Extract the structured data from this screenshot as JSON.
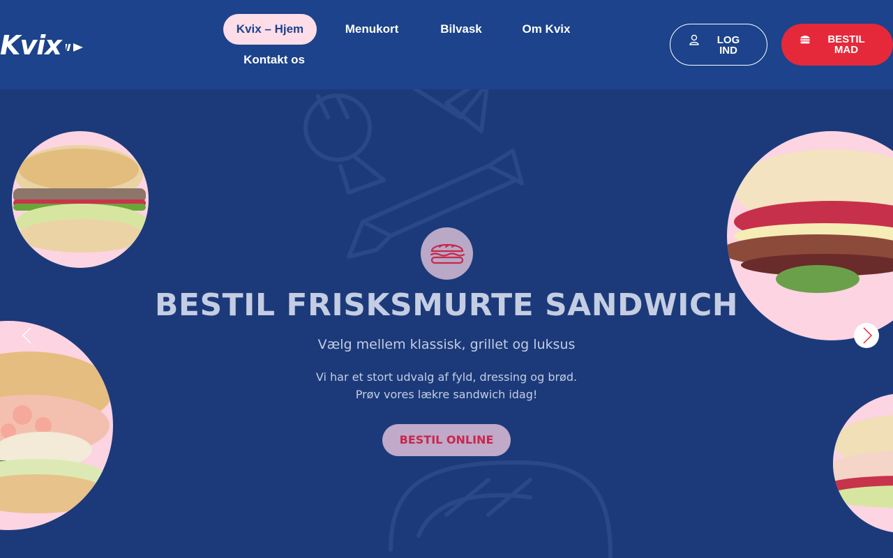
{
  "brand": {
    "name": "Kvix",
    "accent": "#e5293a",
    "header_bg": "#1c438b",
    "hero_bg": "#1c3a7a",
    "pink": "#fcd4e2"
  },
  "nav": {
    "items": [
      {
        "label": "Kvix – Hjem",
        "active": true
      },
      {
        "label": "Menukort",
        "active": false
      },
      {
        "label": "Bilvask",
        "active": false
      },
      {
        "label": "Om Kvix",
        "active": false
      },
      {
        "label": "Kontakt os",
        "active": false
      }
    ]
  },
  "header": {
    "login_label_1": "LOG",
    "login_label_2": "IND",
    "login_icon": "user-icon",
    "order_label_1": "BESTIL",
    "order_label_2": "MAD",
    "order_icon": "burger-icon"
  },
  "hero": {
    "icon": "sandwich-icon",
    "title": "BESTIL FRISKSMURTE SANDWICH",
    "subtitle": "Vælg mellem klassisk, grillet og luksus",
    "text_line_1": "Vi har et stort udvalg af fyld, dressing og brød.",
    "text_line_2": "Prøv vores lækre sandwich idag!",
    "cta_label": "BESTIL ONLINE"
  },
  "slider": {
    "prev_icon": "chevron-left-icon",
    "next_icon": "chevron-right-icon"
  }
}
